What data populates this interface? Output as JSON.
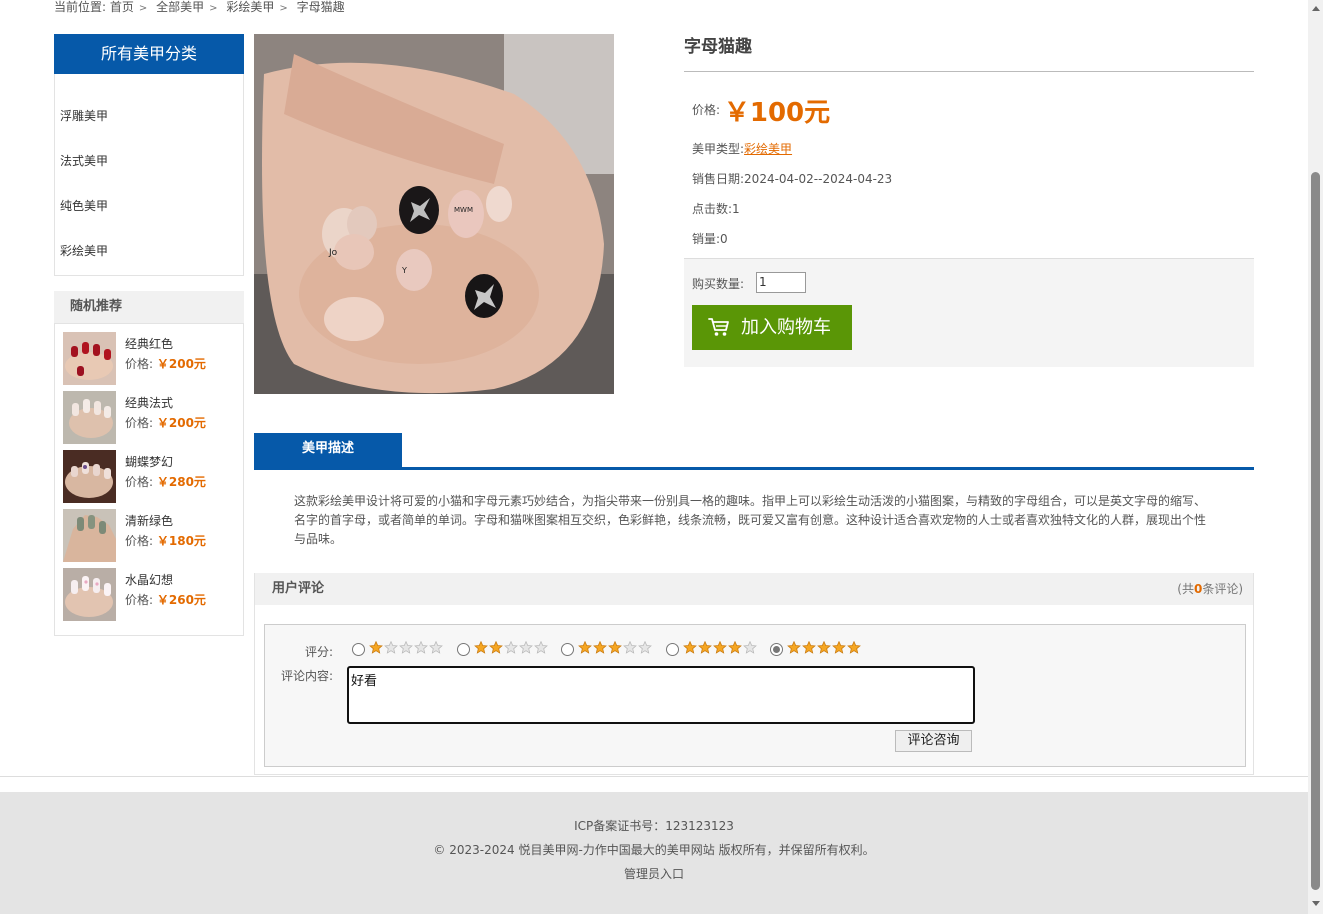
{
  "breadcrumb": {
    "prefix": "当前位置:",
    "items": [
      "首页",
      "全部美甲",
      "彩绘美甲",
      "字母猫趣"
    ],
    "separator": ">"
  },
  "sidebar": {
    "categories_title": "所有美甲分类",
    "categories": [
      "浮雕美甲",
      "法式美甲",
      "纯色美甲",
      "彩绘美甲"
    ],
    "recommend_title": "随机推荐",
    "price_label": "价格:",
    "recommend": [
      {
        "name": "经典红色",
        "price": "￥200元"
      },
      {
        "name": "经典法式",
        "price": "￥200元"
      },
      {
        "name": "蝴蝶梦幻",
        "price": "￥280元"
      },
      {
        "name": "清新绿色",
        "price": "￥180元"
      },
      {
        "name": "水晶幻想",
        "price": "￥260元"
      }
    ]
  },
  "product": {
    "title": "字母猫趣",
    "price_label": "价格:",
    "price": "￥100元",
    "type_label": "美甲类型:",
    "type": "彩绘美甲",
    "date_label": "销售日期:",
    "date": "2024-04-02--2024-04-23",
    "clicks_label": "点击数:",
    "clicks": "1",
    "sales_label": "销量:",
    "sales": "0",
    "qty_label": "购买数量:",
    "qty": "1",
    "cart_button": "加入购物车"
  },
  "description": {
    "tab": "美甲描述",
    "text": "这款彩绘美甲设计将可爱的小猫和字母元素巧妙结合，为指尖带来一份别具一格的趣味。指甲上可以彩绘生动活泼的小猫图案，与精致的字母组合，可以是英文字母的缩写、名字的首字母，或者简单的单词。字母和猫咪图案相互交织，色彩鲜艳，线条流畅，既可爱又富有创意。这种设计适合喜欢宠物的人士或者喜欢独特文化的人群，展现出个性与品味。"
  },
  "comments": {
    "title": "用户评论",
    "count_prefix": "(共",
    "count": "0",
    "count_suffix": "条评论)",
    "score_label": "评分:",
    "rating_options": [
      1,
      2,
      3,
      4,
      5
    ],
    "selected_rating": 5,
    "content_label": "评论内容:",
    "content_value": "好看",
    "submit": "评论咨询"
  },
  "footer": {
    "icp": "ICP备案证书号：123123123",
    "copyright": "© 2023-2024 悦目美甲网-力作中国最大的美甲网站 版权所有，并保留所有权利。",
    "admin": "管理员入口"
  },
  "colors": {
    "brand_blue": "#0659a9",
    "price_orange": "#e36a00",
    "cart_green": "#5a9606",
    "star_gold": "#f5a623"
  }
}
